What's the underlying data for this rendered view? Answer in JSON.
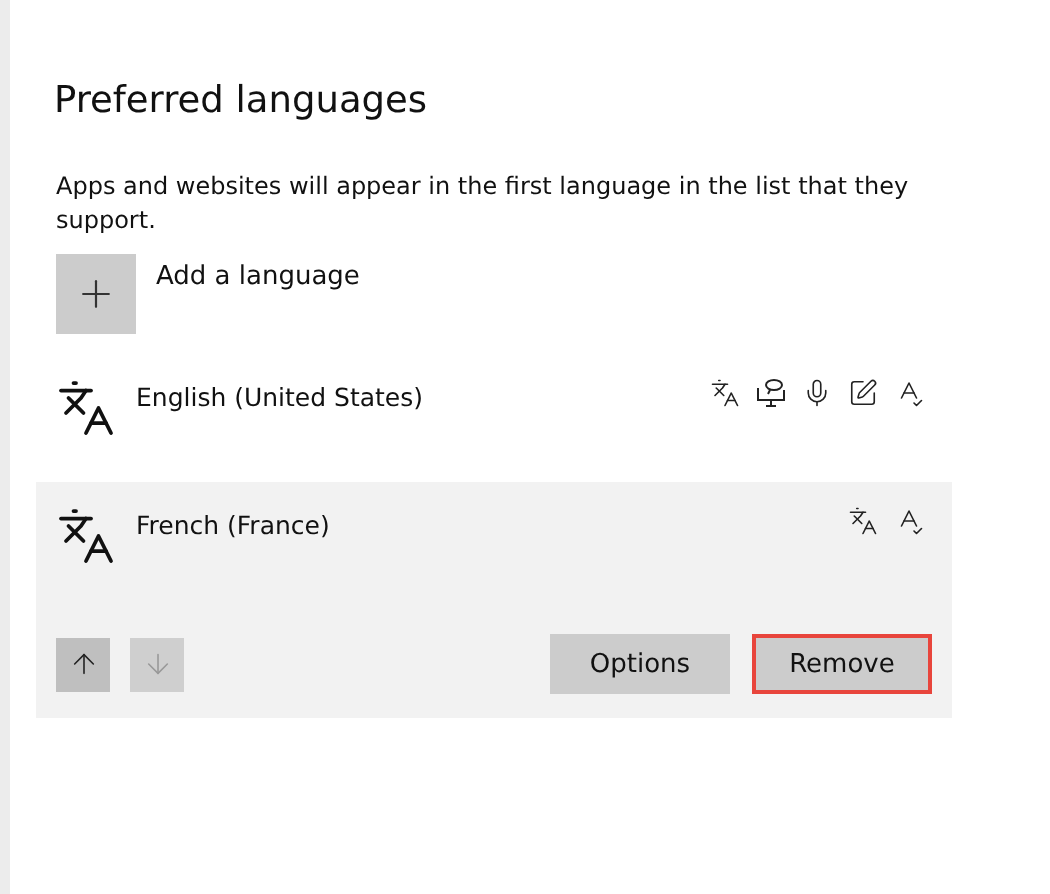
{
  "title": "Preferred languages",
  "description": "Apps and websites will appear in the first language in the list that they support.",
  "add_button": {
    "label": "Add a language"
  },
  "languages": [
    {
      "name": "English (United States)",
      "selected": false,
      "features": [
        {
          "kind": "display"
        },
        {
          "kind": "text-to-speech"
        },
        {
          "kind": "speech"
        },
        {
          "kind": "handwriting"
        },
        {
          "kind": "spelling"
        }
      ]
    },
    {
      "name": "French (France)",
      "selected": true,
      "features": [
        {
          "kind": "display"
        },
        {
          "kind": "spelling"
        }
      ]
    }
  ],
  "move_buttons": [
    {
      "kind": "up",
      "disabled": false
    },
    {
      "kind": "down",
      "disabled": true
    }
  ],
  "actions": [
    {
      "label": "Options",
      "highlighted": false
    },
    {
      "label": "Remove",
      "highlighted": true
    }
  ]
}
